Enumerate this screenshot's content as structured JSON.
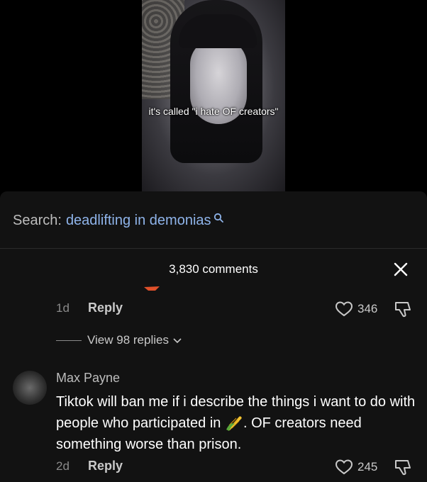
{
  "video": {
    "caption": "it's called \"i hate OF creators\""
  },
  "search": {
    "label": "Search:",
    "term": "deadlifting in demonias"
  },
  "comments_header": {
    "count": "3,830 comments"
  },
  "comments": [
    {
      "time": "1d",
      "reply_label": "Reply",
      "likes": "346",
      "view_replies": "View 98 replies"
    },
    {
      "username": "Max Payne",
      "text_before": "Tiktok will ban me if i describe the things i want to do with people who participated in ",
      "emoji": "corn-emoji",
      "text_after": ". OF creators need something worse than prison.",
      "time": "2d",
      "reply_label": "Reply",
      "likes": "245"
    }
  ],
  "colors": {
    "sheet_background": "#121212",
    "search_term": "#8fb4ea",
    "muted_text": "#8a8a8a"
  }
}
